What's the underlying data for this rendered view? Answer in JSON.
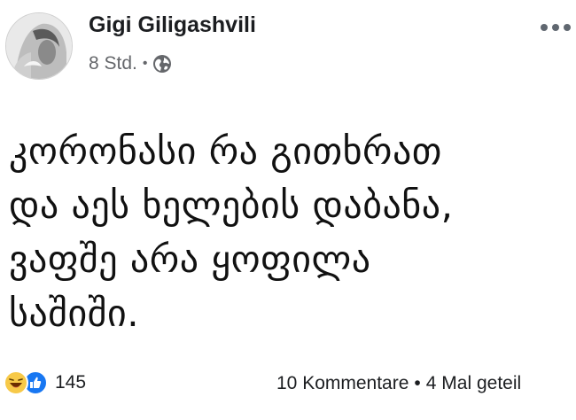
{
  "post": {
    "author": "Gigi Giligashvili",
    "time": "8 Std.",
    "separator": "•",
    "privacy_icon": "globe-icon",
    "text_lines": [
      "კორონასი რა გითხრათ",
      "და აეს ხელების დაბანა,",
      "ვაფშე არა ყოფილა",
      "საშიში."
    ]
  },
  "footer": {
    "reactions": [
      "haha-reaction-icon",
      "like-reaction-icon"
    ],
    "reaction_count": "145",
    "comments": "10 Kommentare",
    "separator": "•",
    "shares": "4 Mal geteil"
  },
  "colors": {
    "text": "#050505",
    "meta": "#65676b",
    "like_blue": "#1877f2",
    "haha_yellow": "#f7c948"
  }
}
